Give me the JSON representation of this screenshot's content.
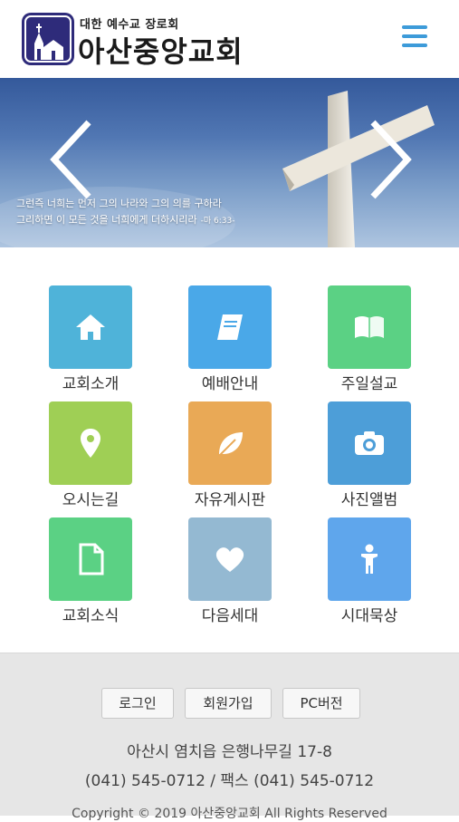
{
  "header": {
    "logo_subtitle": "대한 예수교 장로회",
    "logo_title": "아산중앙교회"
  },
  "banner": {
    "line1": "그런즉 너희는 먼저 그의 나라와 그의 의를 구하라",
    "line2": "그리하면 이 모든 것을 너희에게 더하시리라",
    "reference": "-마 6:33-"
  },
  "menu": [
    {
      "label": "교회소개",
      "icon": "home-icon",
      "color": "#4fb3d9"
    },
    {
      "label": "예배안내",
      "icon": "book-icon",
      "color": "#4aa8e8"
    },
    {
      "label": "주일설교",
      "icon": "open-book-icon",
      "color": "#5bd184"
    },
    {
      "label": "오시는길",
      "icon": "map-pin-icon",
      "color": "#9fcf55"
    },
    {
      "label": "자유게시판",
      "icon": "leaf-icon",
      "color": "#e9a956"
    },
    {
      "label": "사진앨범",
      "icon": "camera-icon",
      "color": "#4d9ed8"
    },
    {
      "label": "교회소식",
      "icon": "document-icon",
      "color": "#5bd184"
    },
    {
      "label": "다음세대",
      "icon": "heart-icon",
      "color": "#94b9d2"
    },
    {
      "label": "시대묵상",
      "icon": "person-icon",
      "color": "#5fa6ec"
    }
  ],
  "footer": {
    "login": "로그인",
    "signup": "회원가입",
    "pc_version": "PC버전",
    "address": "아산시 염치읍 은행나무길 17-8",
    "phone": "(041) 545-0712 / 팩스 (041) 545-0712",
    "copyright": "Copyright © 2019 아산중앙교회 All Rights Reserved"
  }
}
